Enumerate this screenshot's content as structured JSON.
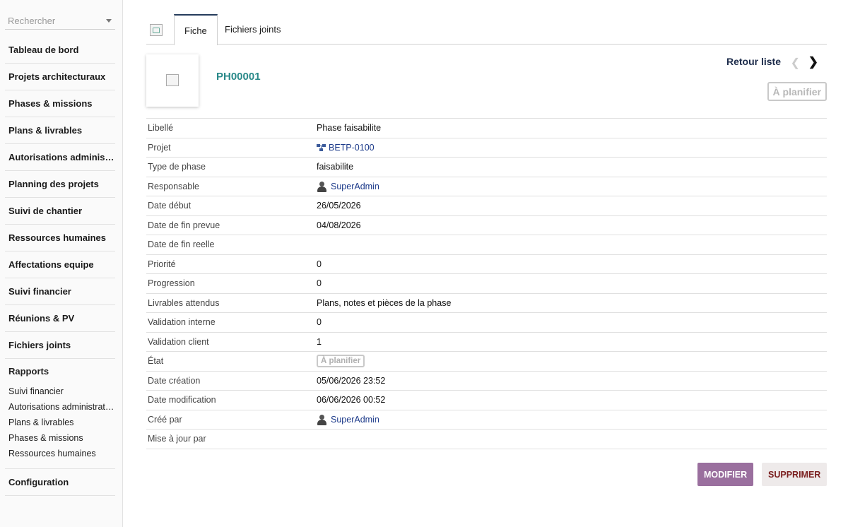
{
  "search": {
    "placeholder": "Rechercher"
  },
  "sidebar": {
    "items": [
      {
        "label": "Tableau de bord"
      },
      {
        "label": "Projets architecturaux"
      },
      {
        "label": "Phases & missions"
      },
      {
        "label": "Plans & livrables"
      },
      {
        "label": "Autorisations administratives"
      },
      {
        "label": "Planning des projets"
      },
      {
        "label": "Suivi de chantier"
      },
      {
        "label": "Ressources humaines"
      },
      {
        "label": "Affectations equipe"
      },
      {
        "label": "Suivi financier"
      },
      {
        "label": "Réunions & PV"
      },
      {
        "label": "Fichiers joints"
      }
    ],
    "rapports": {
      "title": "Rapports",
      "links": [
        {
          "label": "Suivi financier"
        },
        {
          "label": "Autorisations administratives"
        },
        {
          "label": "Plans & livrables"
        },
        {
          "label": "Phases & missions"
        },
        {
          "label": "Ressources humaines"
        }
      ]
    },
    "configuration": "Configuration"
  },
  "tabs": {
    "fiche": "Fiche",
    "fichiers": "Fichiers joints"
  },
  "record": {
    "ref": "PH00001",
    "retour": "Retour liste",
    "prev_icon": "chevron-left-icon",
    "next_icon": "chevron-right-icon",
    "status": "À planifier"
  },
  "fields": [
    {
      "label": "Libellé",
      "value": "Phase faisabilite"
    },
    {
      "label": "Projet",
      "value": "BETP-0100"
    },
    {
      "label": "Type de phase",
      "value": "faisabilite"
    },
    {
      "label": "Responsable",
      "value": "SuperAdmin"
    },
    {
      "label": "Date début",
      "value": "26/05/2026"
    },
    {
      "label": "Date de fin prevue",
      "value": "04/08/2026"
    },
    {
      "label": "Date de fin reelle",
      "value": ""
    },
    {
      "label": "Priorité",
      "value": "0"
    },
    {
      "label": "Progression",
      "value": "0"
    },
    {
      "label": "Livrables attendus",
      "value": "Plans, notes et pièces de la phase"
    },
    {
      "label": "Validation interne",
      "value": "0"
    },
    {
      "label": "Validation client",
      "value": "1"
    },
    {
      "label": "État",
      "value": "À planifier"
    },
    {
      "label": "Date création",
      "value": "05/06/2026 23:52"
    },
    {
      "label": "Date modification",
      "value": "06/06/2026 00:52"
    },
    {
      "label": "Créé par",
      "value": "SuperAdmin"
    },
    {
      "label": "Mise à jour par",
      "value": ""
    }
  ],
  "actions": {
    "modifier": "MODIFIER",
    "supprimer": "SUPPRIMER"
  },
  "colors": {
    "accent": "#2b8a8a",
    "modifier_bg": "#9a6f9e",
    "supprimer_text": "#7a1e1e",
    "link": "#1c3a8a"
  }
}
